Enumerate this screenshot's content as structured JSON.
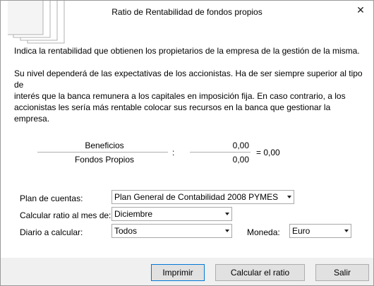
{
  "dialog": {
    "title": "Ratio de Rentabilidad de fondos propios",
    "close_icon": "close-icon",
    "header_icon": "documents-stack-icon"
  },
  "text": {
    "intro": "Indica la rentabilidad que obtienen los propietarios de la empresa de la gestión de la misma.",
    "line1": "Su nivel dependerá de las expectativas de los accionistas. Ha de ser siempre superior al tipo de",
    "line2": "interés que la banca remunera a los capitales en imposición fija. En caso contrario, a los",
    "line3": "accionistas les sería  más rentable colocar sus recursos en la banca que gestionar la empresa."
  },
  "formula": {
    "numerator_label": "Beneficios",
    "denominator_label": "Fondos Propios",
    "colon": ":",
    "numerator_value": "0,00",
    "denominator_value": "0,00",
    "equals": "= 0,00"
  },
  "form": {
    "plan_label": "Plan de cuentas:",
    "plan_value": "Plan General de Contabilidad 2008 PYMES",
    "month_label": "Calcular ratio al mes de:",
    "month_value": "Diciembre",
    "journal_label": "Diario a calcular:",
    "journal_value": "Todos",
    "currency_label": "Moneda:",
    "currency_value": "Euro"
  },
  "buttons": {
    "print": "Imprimir",
    "calculate": "Calcular el ratio",
    "exit": "Salir"
  }
}
